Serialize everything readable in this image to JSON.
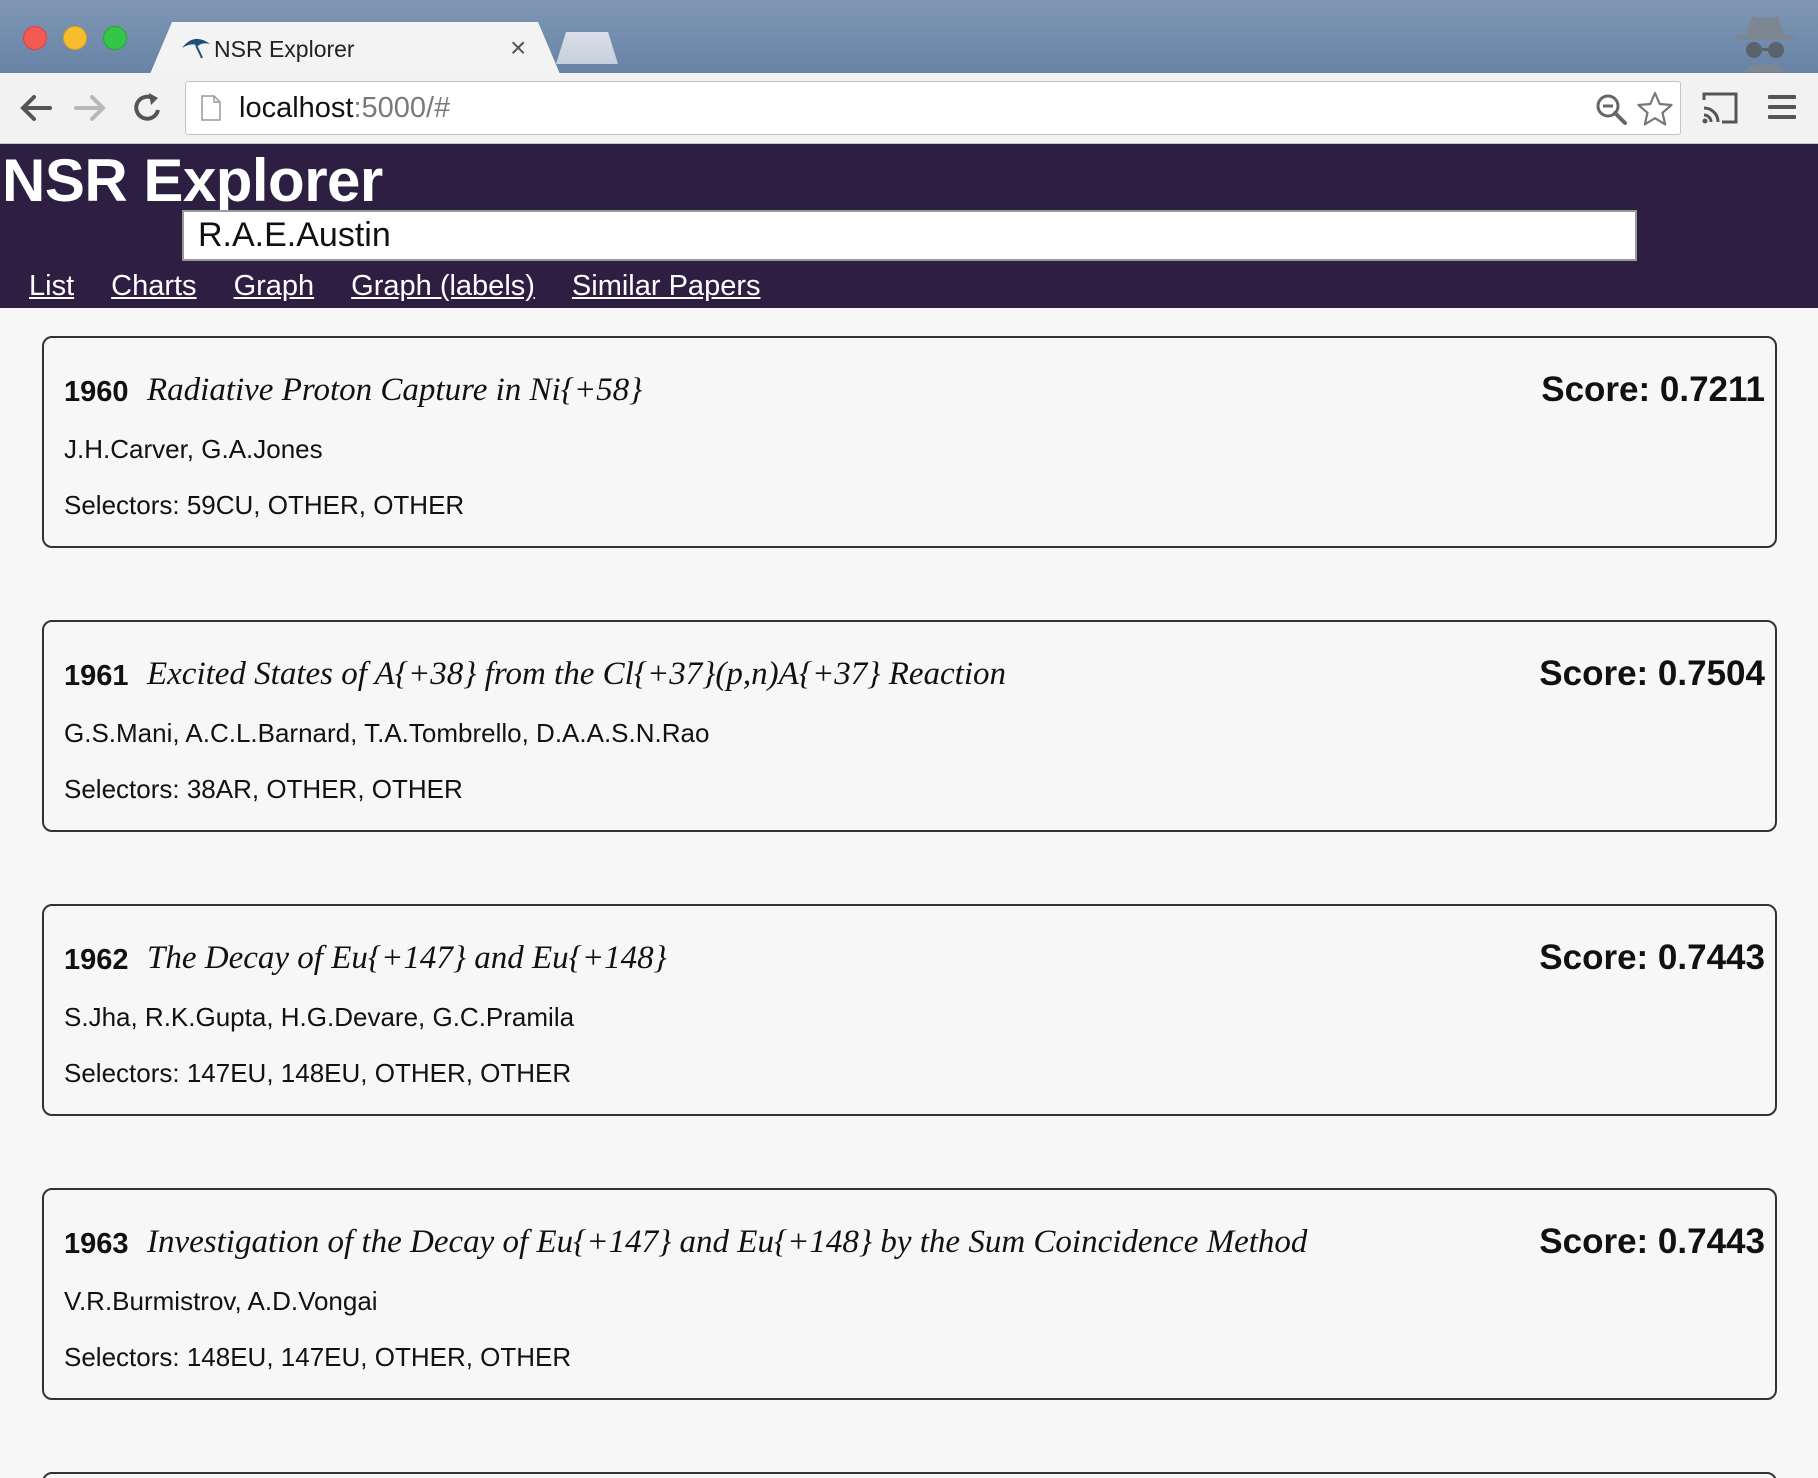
{
  "browser": {
    "tab_title": "NSR Explorer",
    "tab_close": "×",
    "url_host": "localhost",
    "url_rest": ":5000/#"
  },
  "app": {
    "title": "NSR Explorer",
    "search_value": "R.A.E.Austin",
    "nav": [
      "List",
      "Charts",
      "Graph",
      "Graph (labels)",
      "Similar Papers"
    ]
  },
  "results": [
    {
      "year": "1960",
      "title": "Radiative Proton Capture in Ni{+58}",
      "score": "Score: 0.7211",
      "authors": "J.H.Carver, G.A.Jones",
      "selectors": "Selectors: 59CU, OTHER, OTHER"
    },
    {
      "year": "1961",
      "title": "Excited States of A{+38} from the Cl{+37}(p,n)A{+37} Reaction",
      "score": "Score: 0.7504",
      "authors": "G.S.Mani, A.C.L.Barnard, T.A.Tombrello, D.A.A.S.N.Rao",
      "selectors": "Selectors: 38AR, OTHER, OTHER"
    },
    {
      "year": "1962",
      "title": "The Decay of Eu{+147} and Eu{+148}",
      "score": "Score: 0.7443",
      "authors": "S.Jha, R.K.Gupta, H.G.Devare, G.C.Pramila",
      "selectors": "Selectors: 147EU, 148EU, OTHER, OTHER"
    },
    {
      "year": "1963",
      "title": "Investigation of the Decay of Eu{+147} and Eu{+148} by the Sum Coincidence Method",
      "score": "Score: 0.7443",
      "authors": "V.R.Burmistrov, A.D.Vongai",
      "selectors": "Selectors: 148EU, 147EU, OTHER, OTHER"
    }
  ],
  "colors": {
    "header_bg": "#2d1f42",
    "page_bg": "#f7f7f7"
  },
  "icons": [
    "back-arrow-icon",
    "forward-arrow-icon",
    "reload-icon",
    "page-icon",
    "zoom-icon",
    "star-icon",
    "cast-icon",
    "menu-icon",
    "incognito-icon",
    "umbrella-favicon-icon"
  ]
}
